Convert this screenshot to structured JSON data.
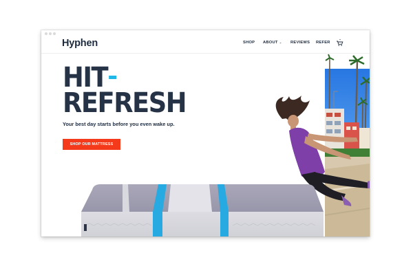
{
  "brand": {
    "logo": "Hyphen"
  },
  "nav": {
    "items": [
      {
        "label": "SHOP"
      },
      {
        "label": "ABOUT"
      },
      {
        "label": "REVIEWS"
      },
      {
        "label": "REFER"
      }
    ],
    "about_caret": "⌄",
    "cart_icon": "cart-icon"
  },
  "hero": {
    "headline_line1": "HIT",
    "headline_line2": "REFRESH",
    "subtitle": "Your best day starts before you even wake up.",
    "cta": "SHOP OUR MATTRESS"
  },
  "colors": {
    "brand_dark": "#1d2b3f",
    "accent_blue": "#1fb6e8",
    "cta_red": "#f53a1b"
  }
}
